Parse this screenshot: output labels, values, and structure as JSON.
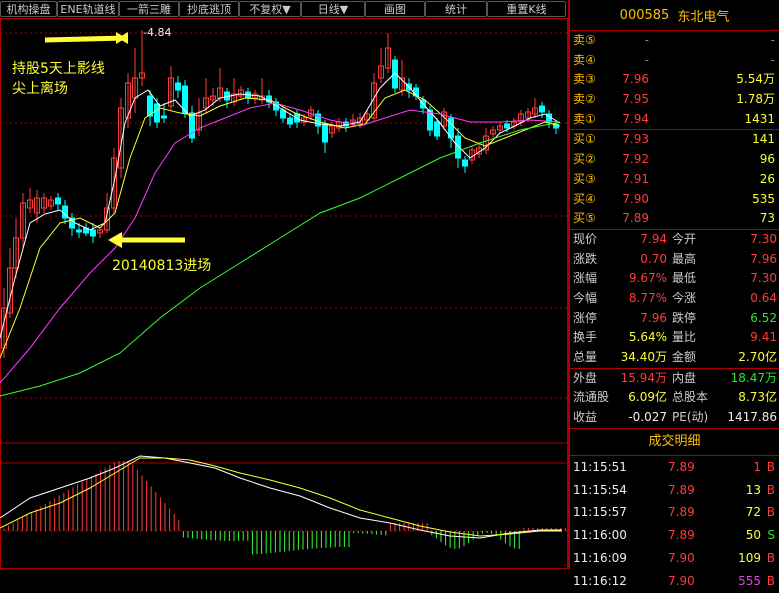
{
  "toolbar": {
    "buttons": [
      "机构操盘",
      "ENE轨道线",
      "一箭三雕",
      "抄底逃顶",
      "不复权▼",
      "日线▼",
      "画图",
      "统计",
      "重置K线"
    ]
  },
  "annotations": {
    "high_label": "-4.84",
    "note_top_line1": "持股5天上影线",
    "note_top_line2": "尖上离场",
    "note_entry": "20140813进场"
  },
  "stock": {
    "code": "000585",
    "name": "东北电气"
  },
  "order_book": {
    "asks": [
      {
        "label": "卖⑤",
        "price": "-",
        "vol": "-"
      },
      {
        "label": "卖④",
        "price": "-",
        "vol": "-"
      },
      {
        "label": "卖③",
        "price": "7.96",
        "vol": "5.54万"
      },
      {
        "label": "卖②",
        "price": "7.95",
        "vol": "1.78万"
      },
      {
        "label": "卖①",
        "price": "7.94",
        "vol": "1431"
      }
    ],
    "bids": [
      {
        "label": "买①",
        "price": "7.93",
        "vol": "141"
      },
      {
        "label": "买②",
        "price": "7.92",
        "vol": "96"
      },
      {
        "label": "买③",
        "price": "7.91",
        "vol": "26"
      },
      {
        "label": "买④",
        "price": "7.90",
        "vol": "535"
      },
      {
        "label": "买⑤",
        "price": "7.89",
        "vol": "73"
      }
    ]
  },
  "quote": {
    "rows": [
      {
        "l1": "现价",
        "v1": "7.94",
        "c1": "red",
        "l2": "今开",
        "v2": "7.30",
        "c2": "red"
      },
      {
        "l1": "涨跌",
        "v1": "0.70",
        "c1": "red",
        "l2": "最高",
        "v2": "7.96",
        "c2": "red"
      },
      {
        "l1": "涨幅",
        "v1": "9.67%",
        "c1": "red",
        "l2": "最低",
        "v2": "7.30",
        "c2": "red"
      },
      {
        "l1": "今幅",
        "v1": "8.77%",
        "c1": "red",
        "l2": "今涨",
        "v2": "0.64",
        "c2": "red"
      },
      {
        "l1": "涨停",
        "v1": "7.96",
        "c1": "red",
        "l2": "跌停",
        "v2": "6.52",
        "c2": "green"
      },
      {
        "l1": "换手",
        "v1": "5.64%",
        "c1": "yellow",
        "l2": "量比",
        "v2": "9.41",
        "c2": "red"
      },
      {
        "l1": "总量",
        "v1": "34.40万",
        "c1": "yellow",
        "l2": "金额",
        "v2": "2.70亿",
        "c2": "yellow"
      },
      {
        "l1": "外盘",
        "v1": "15.94万",
        "c1": "red",
        "l2": "内盘",
        "v2": "18.47万",
        "c2": "green"
      },
      {
        "l1": "流通股",
        "v1": "6.09亿",
        "c1": "yellow",
        "l2": "总股本",
        "v2": "8.73亿",
        "c2": "yellow"
      },
      {
        "l1": "收益",
        "v1": "-0.027",
        "c1": "white",
        "l2": "PE(动)",
        "v2": "1417.86",
        "c2": "white"
      }
    ]
  },
  "trades": {
    "title": "成交明细",
    "rows": [
      {
        "time": "11:15:51",
        "price": "7.89",
        "vol": "1",
        "side": "B",
        "vc": "red",
        "sc": "red"
      },
      {
        "time": "11:15:54",
        "price": "7.89",
        "vol": "13",
        "side": "B",
        "vc": "yellow",
        "sc": "red"
      },
      {
        "time": "11:15:57",
        "price": "7.89",
        "vol": "72",
        "side": "B",
        "vc": "yellow",
        "sc": "red"
      },
      {
        "time": "11:16:00",
        "price": "7.89",
        "vol": "50",
        "side": "S",
        "vc": "yellow",
        "sc": "green"
      },
      {
        "time": "11:16:09",
        "price": "7.90",
        "vol": "109",
        "side": "B",
        "vc": "yellow",
        "sc": "red"
      },
      {
        "time": "11:16:12",
        "price": "7.90",
        "vol": "555",
        "side": "B",
        "vc": "purple",
        "sc": "red"
      }
    ]
  },
  "colors": {
    "up": "#ff3b3b",
    "down": "#00ffff",
    "ma5": "#ffffff",
    "ma10": "#ffff33",
    "ma20": "#ff3bff",
    "ma60": "#33ff33",
    "frame": "#aa0000"
  }
}
